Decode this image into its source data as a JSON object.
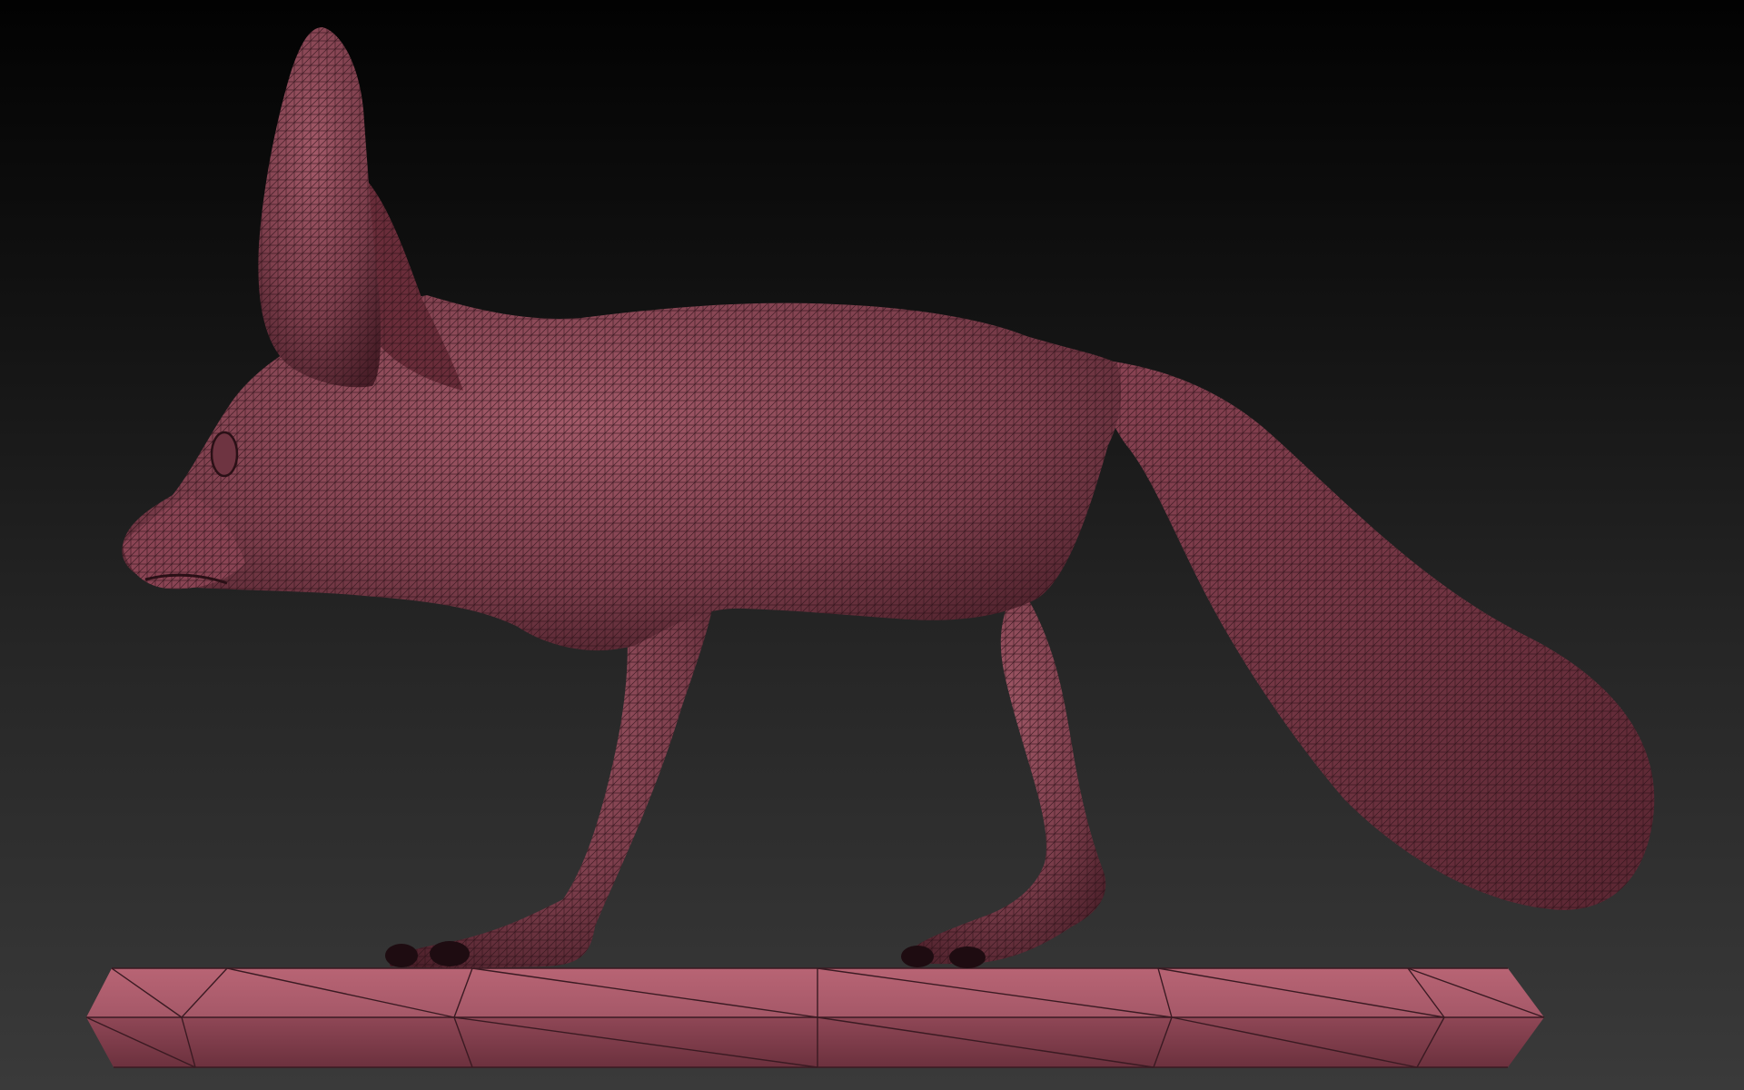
{
  "viewport": {
    "background_top": "#020202",
    "background_bottom": "#3a3a3a"
  },
  "model": {
    "subject": "fennec-fox",
    "display_mode": "wireframe-polyframe",
    "surface_color": "#7e3f4d",
    "surface_highlight": "#a35a69",
    "wire_color": "#2a1016"
  },
  "base": {
    "surface_color": "#a55868",
    "shade_color": "#7a3a48"
  }
}
